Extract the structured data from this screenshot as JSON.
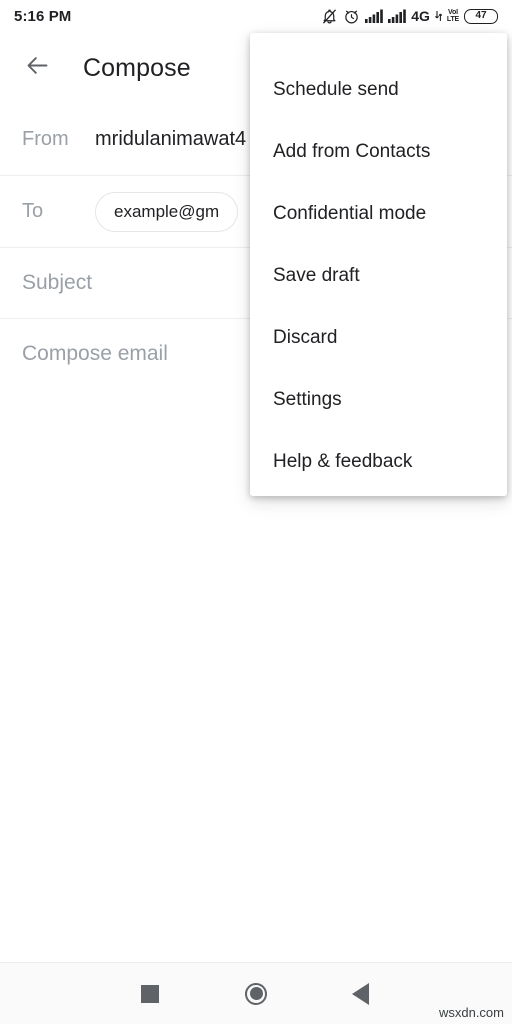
{
  "status_bar": {
    "time": "5:16 PM",
    "icons": [
      "notifications-off-icon",
      "alarm-clock-icon",
      "signal-bars-icon",
      "signal-bars-icon",
      "4g-label",
      "data-transfer-icon",
      "volte-label"
    ],
    "network_label": "4G",
    "volte_top": "VoI",
    "volte_bottom": "LTE",
    "battery_level": "47"
  },
  "app_bar": {
    "back_icon": "arrow-back-icon",
    "title": "Compose"
  },
  "form": {
    "from_label": "From",
    "from_value": "mridulanimawat4",
    "to_label": "To",
    "to_chip": "example@gm",
    "subject_placeholder": "Subject",
    "body_placeholder": "Compose email"
  },
  "overflow_menu": {
    "items": [
      {
        "label": "Schedule send"
      },
      {
        "label": "Add from Contacts"
      },
      {
        "label": "Confidential mode"
      },
      {
        "label": "Save draft"
      },
      {
        "label": "Discard"
      },
      {
        "label": "Settings"
      },
      {
        "label": "Help & feedback"
      }
    ]
  },
  "nav_bar": {
    "recents_icon": "square-recents-icon",
    "home_icon": "circle-home-icon",
    "back_icon": "triangle-back-icon"
  },
  "watermark": "wsxdn.com",
  "colors": {
    "text_primary": "#202124",
    "text_secondary": "#9aa0a6",
    "divider": "#eceff1",
    "nav_icon": "#5f6368",
    "nav_background": "#fafafa"
  }
}
